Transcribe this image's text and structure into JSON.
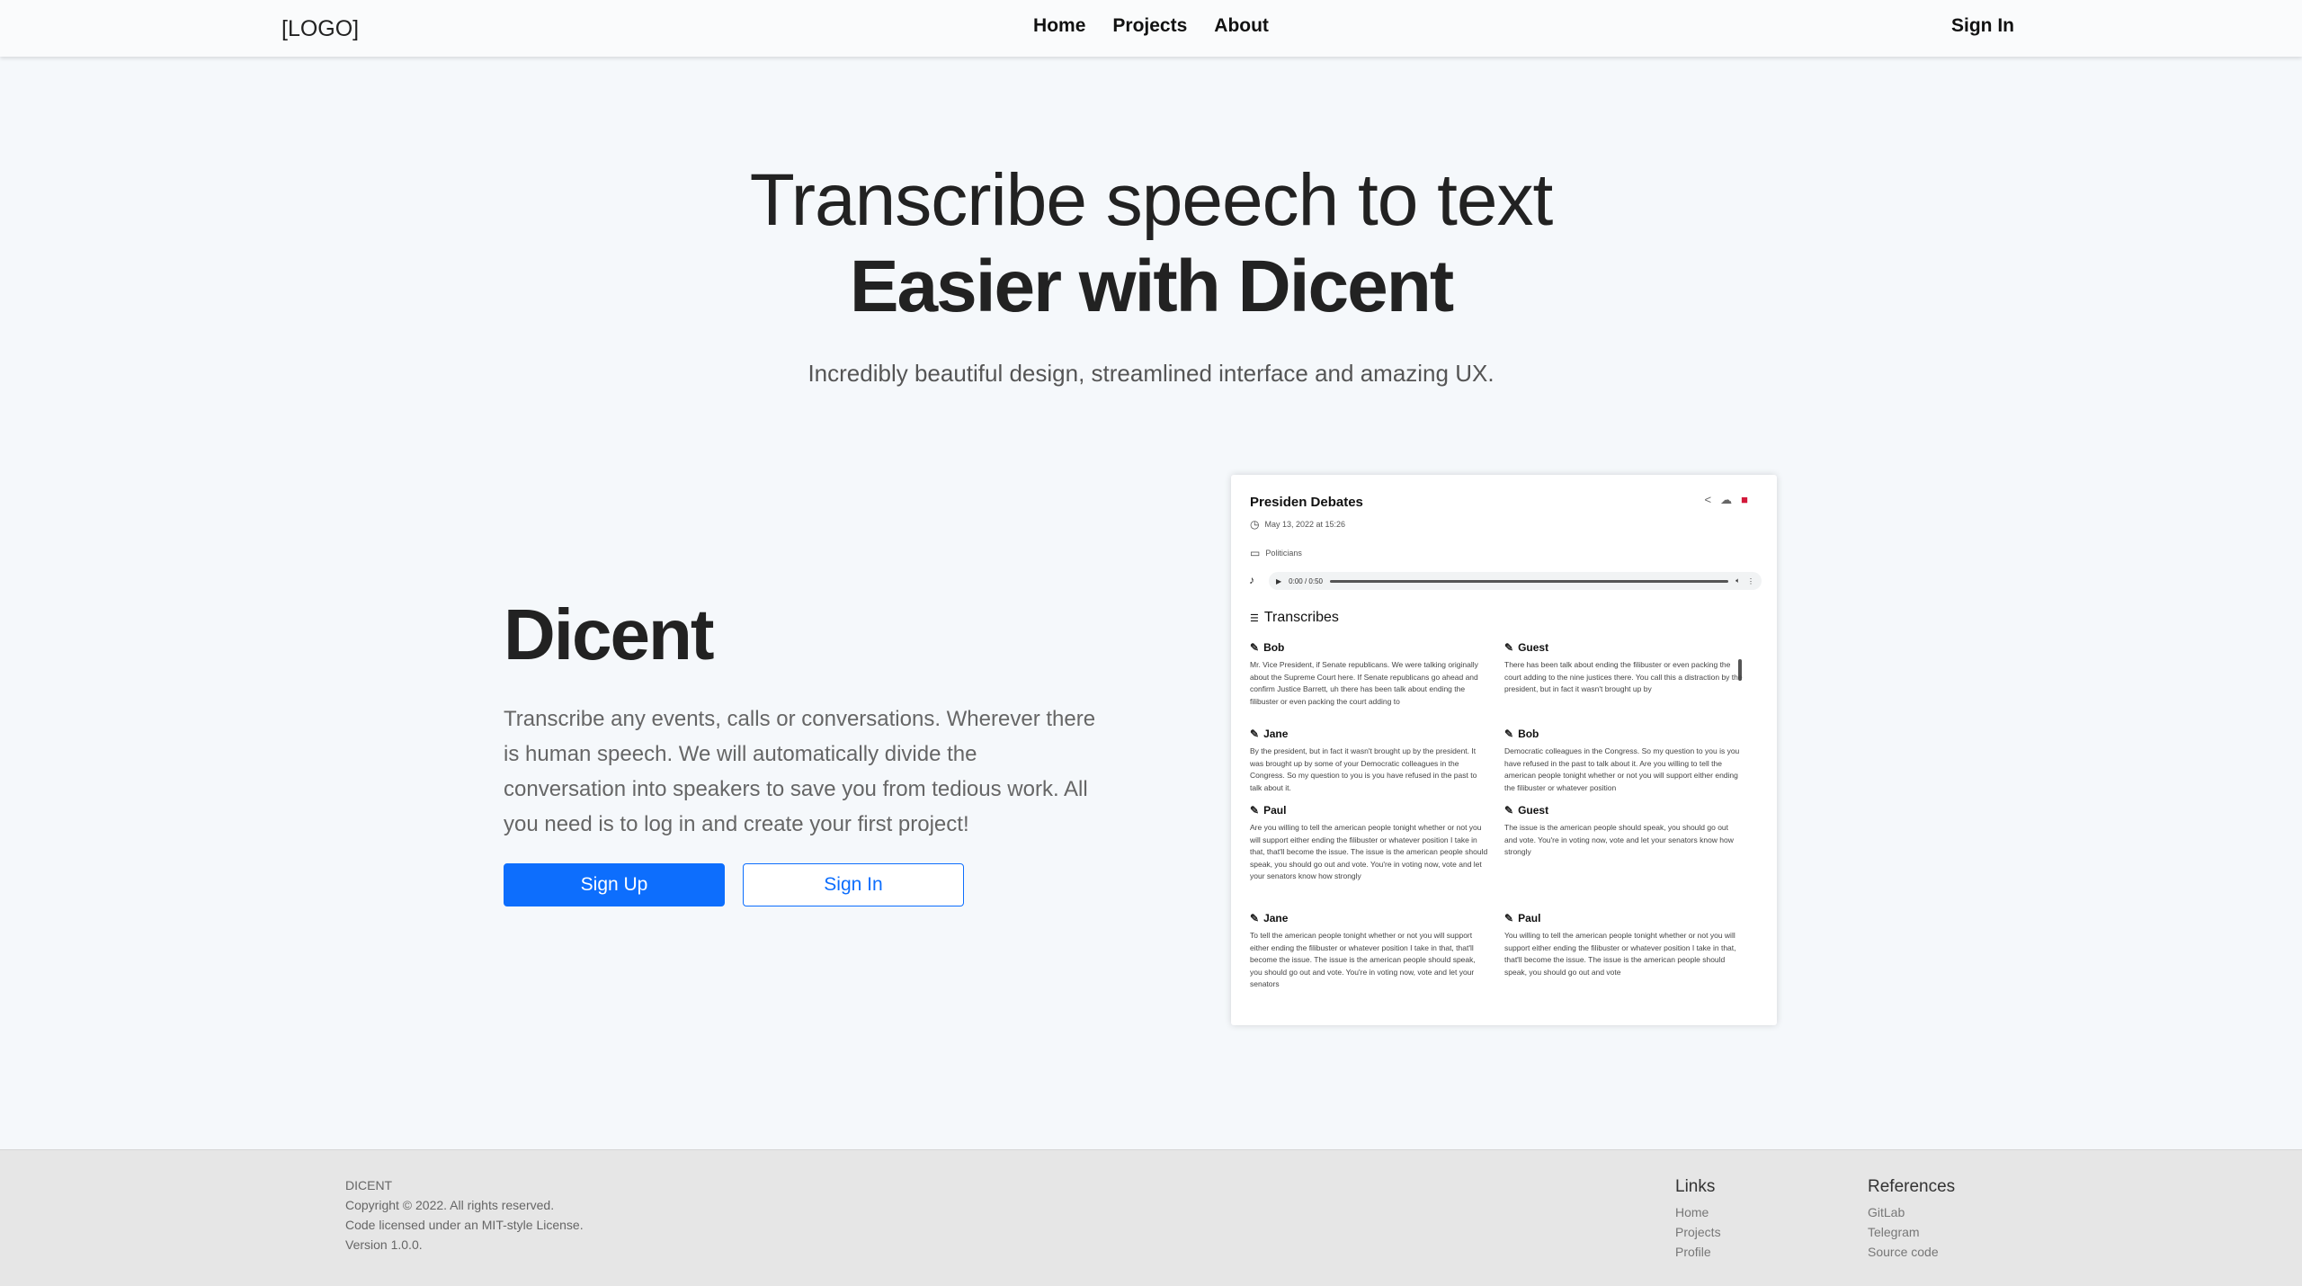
{
  "header": {
    "logo": "[LOGO]",
    "nav": [
      "Home",
      "Projects",
      "About"
    ],
    "sign_in": "Sign In"
  },
  "hero": {
    "line1": "Transcribe speech to text",
    "line2": "Easier with Dicent",
    "subtitle": "Incredibly beautiful design, streamlined interface and amazing UX."
  },
  "intro": {
    "title": "Dicent",
    "text": "Transcribe any events, calls or conversations. Wherever there is human speech. We will automatically divide the conversation into speakers to save you from tedious work. All you need is to log in and create your first project!",
    "sign_up": "Sign Up",
    "sign_in": "Sign In"
  },
  "preview": {
    "title": "Presiden Debates",
    "date": "May 13, 2022 at 15:26",
    "folder": "Politicians",
    "player_time": "0:00 / 0:50",
    "section_label": "Transcribes",
    "segments": [
      {
        "speaker": "Bob",
        "text": "Mr. Vice President, if Senate republicans. We were talking originally about the Supreme Court here. If Senate republicans go ahead and confirm Justice Barrett, uh there has been talk about ending the filibuster or even packing the court adding to"
      },
      {
        "speaker": "Guest",
        "text": "There has been talk about ending the filibuster or even packing the court adding to the nine justices there. You call this a distraction by the president, but in fact it wasn't brought up by"
      },
      {
        "speaker": "Jane",
        "text": "By the president, but in fact it wasn't brought up by the president. It was brought up by some of your Democratic colleagues in the Congress. So my question to you is you have refused in the past to talk about it."
      },
      {
        "speaker": "Bob",
        "text": "Democratic colleagues in the Congress. So my question to you is you have refused in the past to talk about it. Are you willing to tell the american people tonight whether or not you will support either ending the filibuster or whatever position"
      },
      {
        "speaker": "Paul",
        "text": "Are you willing to tell the american people tonight whether or not you will support either ending the filibuster or whatever position I take in that, that'll become the issue. The issue is the american people should speak, you should go out and vote. You're in voting now, vote and let your senators know how strongly"
      },
      {
        "speaker": "Guest",
        "text": "The issue is the american people should speak, you should go out and vote. You're in voting now, vote and let your senators know how strongly"
      },
      {
        "speaker": "Jane",
        "text": "To tell the american people tonight whether or not you will support either ending the filibuster or whatever position I take in that, that'll become the issue. The issue is the american people should speak, you should go out and vote. You're in voting now, vote and let your senators"
      },
      {
        "speaker": "Paul",
        "text": "You willing to tell the american people tonight whether or not you will support either ending the filibuster or whatever position I take in that, that'll become the issue. The issue is the american people should speak, you should go out and vote"
      }
    ]
  },
  "footer": {
    "brand": "DICENT",
    "copyright": "Copyright © 2022. All rights reserved.",
    "license": "Code licensed under an MIT-style License.",
    "version": "Version 1.0.0.",
    "links_title": "Links",
    "links": [
      "Home",
      "Projects",
      "Profile"
    ],
    "refs_title": "References",
    "refs": [
      "GitLab",
      "Telegram",
      "Source code"
    ]
  },
  "colors": {
    "primary": "#0d6efd",
    "background": "#f5f8fb",
    "footer": "#e6e6e6",
    "delete": "#d3193a"
  },
  "icons": [
    "share-icon",
    "cloud-upload-icon",
    "trash-icon",
    "clock-icon",
    "folder-icon",
    "music-note-icon",
    "play-icon",
    "volume-icon",
    "more-icon",
    "list-icon",
    "pencil-icon"
  ]
}
